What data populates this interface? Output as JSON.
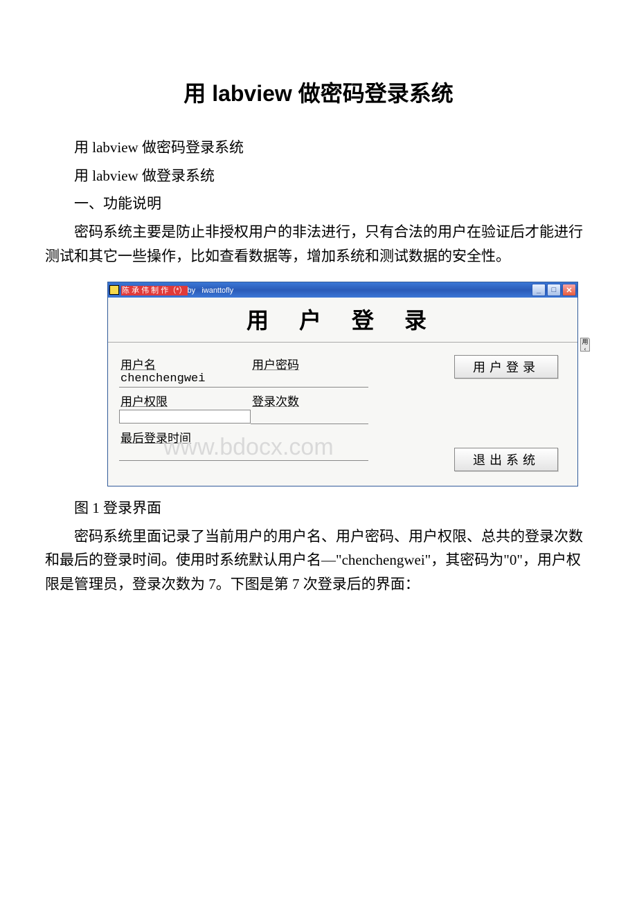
{
  "title": "用 labview 做密码登录系统",
  "p1": "用 labview 做密码登录系统",
  "p2": "用 labview 做登录系统",
  "p3": "一、功能说明",
  "p4": "密码系统主要是防止非授权用户的非法进行，只有合法的用户在验证后才能进行测试和其它一些操作，比如查看数据等，增加系统和测试数据的安全性。",
  "figure_caption": "图 1 登录界面",
  "p5": "密码系统里面记录了当前用户的用户名、用户密码、用户权限、总共的登录次数和最后的登录时间。使用时系统默认用户名—\"chenchengwei\"，其密码为\"0\"，用户权限是管理员，登录次数为 7。下图是第 7 次登录后的界面：",
  "app": {
    "titlebar_red": "陈 承 伟 制 作（*）",
    "titlebar_by": "by",
    "titlebar_author": "iwanttofly",
    "header": "用 户 登 录",
    "labels": {
      "username": "用户名",
      "password": "用户密码",
      "permission": "用户权限",
      "login_count": "登录次数",
      "last_login": "最后登录时间"
    },
    "values": {
      "username": "chenchengwei"
    },
    "buttons": {
      "login": "用户登录",
      "exit": "退出系统"
    },
    "watermark": "www.bdocx.com"
  }
}
